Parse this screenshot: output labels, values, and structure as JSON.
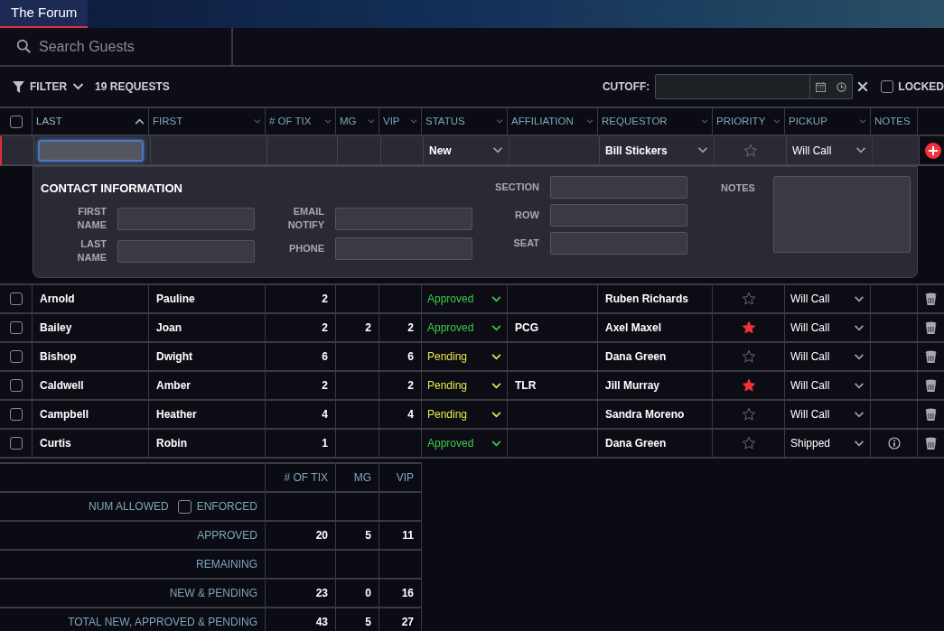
{
  "tabs": [
    {
      "label": "The Forum",
      "selected": true
    }
  ],
  "search": {
    "placeholder": "Search Guests"
  },
  "toolbar": {
    "filter_label": "FILTER",
    "request_count": "19 REQUESTS",
    "cutoff_label": "CUTOFF:",
    "locked": {
      "label": "LOCKED",
      "checked": false
    }
  },
  "table": {
    "select_all": {
      "checked": false
    },
    "columns": [
      {
        "label": "LAST",
        "sortable": true,
        "sorted": true
      },
      {
        "label": "FIRST",
        "sortable": true,
        "sorted": false
      },
      {
        "label": "# OF TIX",
        "sortable": true,
        "sorted": false
      },
      {
        "label": "MG",
        "sortable": true,
        "sorted": false
      },
      {
        "label": "VIP",
        "sortable": true,
        "sorted": false
      },
      {
        "label": "STATUS",
        "sortable": true,
        "sorted": false
      },
      {
        "label": "AFFILIATION",
        "sortable": true,
        "sorted": false
      },
      {
        "label": "REQUESTOR",
        "sortable": true,
        "sorted": false
      },
      {
        "label": "PRIORITY",
        "sortable": true,
        "sorted": false
      },
      {
        "label": "PICKUP",
        "sortable": true,
        "sorted": false
      },
      {
        "label": "NOTES",
        "sortable": false,
        "sorted": false
      }
    ],
    "new_row": {
      "last_focused": true,
      "status": "New",
      "requestor": "Bill Stickers",
      "priority": false,
      "pickup": "Will Call"
    },
    "contact_panel": {
      "title": "CONTACT INFORMATION",
      "left_fields": [
        "FIRST NAME",
        "LAST NAME"
      ],
      "middle_fields": [
        "EMAIL NOTIFY",
        "PHONE"
      ],
      "right_fields": [
        "SECTION",
        "ROW",
        "SEAT"
      ],
      "notes_label": "NOTES"
    },
    "rows": [
      {
        "checked": false,
        "last": "Arnold",
        "first": "Pauline",
        "tix": "2",
        "status": {
          "label": "Approved",
          "kind": "approved"
        },
        "requestor": "Ruben Richards",
        "priority": false,
        "pickup": "Will Call",
        "has_notes": false
      },
      {
        "checked": false,
        "last": "Bailey",
        "first": "Joan",
        "tix": "2",
        "mg": "2",
        "vip": "2",
        "status": {
          "label": "Approved",
          "kind": "approved"
        },
        "affiliation": "PCG",
        "requestor": "Axel Maxel",
        "priority": true,
        "pickup": "Will Call",
        "has_notes": false
      },
      {
        "checked": false,
        "last": "Bishop",
        "first": "Dwight",
        "tix": "6",
        "vip": "6",
        "status": {
          "label": "Pending",
          "kind": "pending"
        },
        "requestor": "Dana Green",
        "priority": false,
        "pickup": "Will Call",
        "has_notes": false
      },
      {
        "checked": false,
        "last": "Caldwell",
        "first": "Amber",
        "tix": "2",
        "vip": "2",
        "status": {
          "label": "Pending",
          "kind": "pending"
        },
        "affiliation": "TLR",
        "requestor": "Jill Murray",
        "priority": true,
        "pickup": "Will Call",
        "has_notes": false
      },
      {
        "checked": false,
        "last": "Campbell",
        "first": "Heather",
        "tix": "4",
        "vip": "4",
        "status": {
          "label": "Pending",
          "kind": "pending"
        },
        "requestor": "Sandra Moreno",
        "priority": false,
        "pickup": "Will Call",
        "has_notes": false
      },
      {
        "checked": false,
        "last": "Curtis",
        "first": "Robin",
        "tix": "1",
        "status": {
          "label": "Approved",
          "kind": "approved"
        },
        "requestor": "Dana Green",
        "priority": false,
        "pickup": "Shipped",
        "has_notes": true
      }
    ]
  },
  "summary": {
    "columns": [
      "# OF TIX",
      "MG",
      "VIP"
    ],
    "rows": [
      {
        "label": "NUM ALLOWED",
        "enforced": {
          "label": "ENFORCED",
          "checked": false
        }
      },
      {
        "label": "APPROVED",
        "values": [
          "20",
          "5",
          "11"
        ]
      },
      {
        "label": "REMAINING"
      },
      {
        "label": "NEW & PENDING",
        "values": [
          "23",
          "0",
          "16"
        ]
      },
      {
        "label": "TOTAL NEW, APPROVED & PENDING",
        "values": [
          "43",
          "5",
          "27"
        ]
      }
    ]
  }
}
